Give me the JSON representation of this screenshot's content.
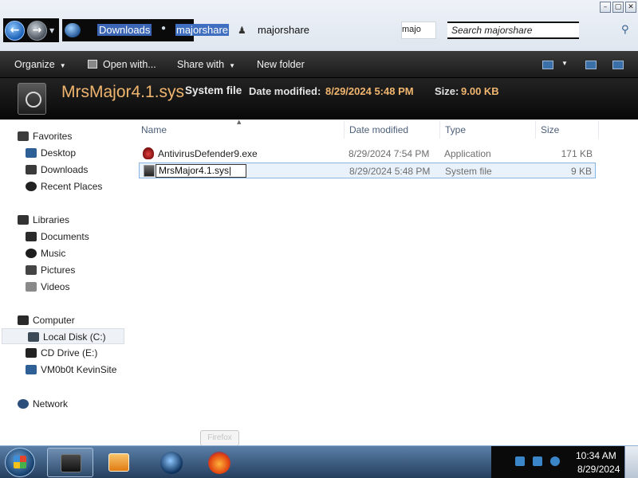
{
  "window": {
    "controls": [
      "minimize",
      "maximize",
      "close"
    ],
    "nav": {
      "back_icon": "back-arrow-icon",
      "forward_icon": "forward-arrow-icon"
    },
    "address": {
      "crumbs": [
        "Downloads",
        "majorshare",
        "majorshare"
      ],
      "mini_field": "majo"
    },
    "search": {
      "placeholder": "Search majorshare"
    }
  },
  "toolbar": {
    "organize": "Organize",
    "open_with": "Open with...",
    "share_with": "Share with",
    "new_folder": "New folder"
  },
  "details": {
    "file_name": "MrsMajor4.1.sys",
    "file_type": "System file",
    "modified_label": "Date modified:",
    "modified_value": "8/29/2024 5:48 PM",
    "size_label": "Size:",
    "size_value": "9.00 KB"
  },
  "navigation": {
    "favorites": {
      "label": "Favorites",
      "items": [
        "Desktop",
        "Downloads",
        "Recent Places"
      ]
    },
    "libraries": {
      "label": "Libraries",
      "items": [
        "Documents",
        "Music",
        "Pictures",
        "Videos"
      ]
    },
    "computer": {
      "label": "Computer",
      "items": [
        "Local Disk (C:)",
        "CD Drive (E:)",
        "VM0b0t KevinSite"
      ],
      "selected": "Local Disk (C:)"
    },
    "network": {
      "label": "Network"
    }
  },
  "file_list": {
    "columns": [
      "Name",
      "Date modified",
      "Type",
      "Size"
    ],
    "rows": [
      {
        "name": "AntivirusDefender9.exe",
        "date": "8/29/2024 7:54 PM",
        "type": "Application",
        "size": "171 KB",
        "icon": "antivirus-exe-icon"
      },
      {
        "name": "MrsMajor4.1.sys",
        "date": "8/29/2024 5:48 PM",
        "type": "System file",
        "size": "9 KB",
        "icon": "system-file-icon",
        "renaming": true
      }
    ]
  },
  "tooltip": {
    "text": "Firefox"
  },
  "taskbar": {
    "apps": [
      "windows-explorer",
      "windows-media-player",
      "internet-explorer",
      "firefox"
    ],
    "clock": {
      "time": "10:34 AM",
      "date": "8/29/2024"
    }
  },
  "colors": {
    "accent_orange": "#f0b56e",
    "selection_blue": "#89b4df",
    "command_bar_dark": "#1a1a1a"
  }
}
